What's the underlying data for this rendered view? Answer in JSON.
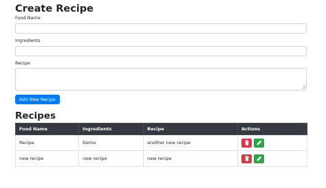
{
  "form": {
    "title": "Create Recipe",
    "food_name_label": "Food Name",
    "food_name_value": "",
    "ingredients_label": "Ingredients",
    "ingredients_value": "",
    "recipe_label": "Recipe",
    "recipe_value": "",
    "submit_label": "Add New Recipe"
  },
  "recipes": {
    "title": "Recipes",
    "columns": [
      "Food Name",
      "Ingredients",
      "Recipe",
      "Actions"
    ],
    "rows": [
      {
        "food_name": "Recipe",
        "ingredients": "Demo",
        "recipe": "another new recipe"
      },
      {
        "food_name": "new recipe",
        "ingredients": "new recipe",
        "recipe": "new recipe"
      }
    ]
  },
  "icons": {
    "delete": "trash-icon",
    "edit": "pencil-icon"
  },
  "colors": {
    "primary": "#007bff",
    "danger": "#dc3545",
    "success": "#28a745",
    "table_header": "#343a40"
  }
}
